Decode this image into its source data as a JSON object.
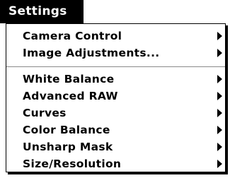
{
  "menu": {
    "title": "Settings",
    "groups": [
      {
        "items": [
          {
            "label": "Camera Control",
            "has_submenu": true
          },
          {
            "label": "Image Adjustments...",
            "has_submenu": true
          }
        ]
      },
      {
        "items": [
          {
            "label": "White Balance",
            "has_submenu": true
          },
          {
            "label": "Advanced RAW",
            "has_submenu": true
          },
          {
            "label": "Curves",
            "has_submenu": true
          },
          {
            "label": "Color Balance",
            "has_submenu": true
          },
          {
            "label": "Unsharp Mask",
            "has_submenu": true
          },
          {
            "label": "Size/Resolution",
            "has_submenu": true
          }
        ]
      }
    ]
  },
  "icons": {
    "submenu_indicator": "chevron-right-icon"
  },
  "colors": {
    "title_background": "#000000",
    "title_text": "#ffffff",
    "menu_background": "#ffffff",
    "menu_text": "#000000",
    "separator": "#8a8a8a"
  }
}
